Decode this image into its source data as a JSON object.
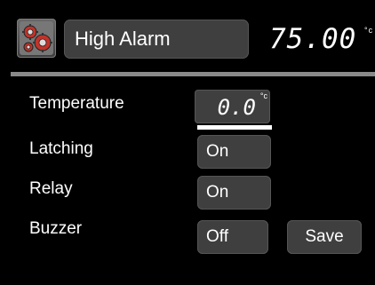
{
  "header": {
    "title": "High Alarm",
    "value": "75.00",
    "unit": "°c",
    "settings_icon": "gears-icon"
  },
  "rows": [
    {
      "label": "Temperature",
      "value": "0.0",
      "unit": "°c"
    },
    {
      "label": "Latching",
      "value": "On"
    },
    {
      "label": "Relay",
      "value": "On"
    },
    {
      "label": "Buzzer",
      "value": "Off"
    }
  ],
  "save_label": "Save"
}
